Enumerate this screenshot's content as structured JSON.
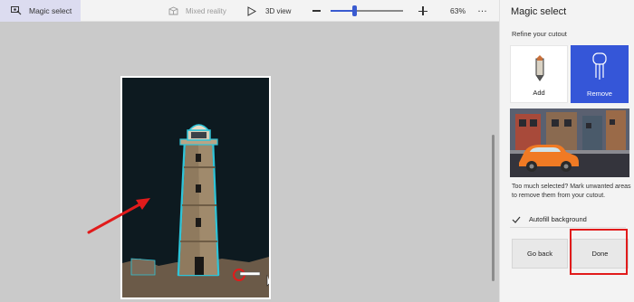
{
  "toolbar": {
    "active_tool": "Magic select",
    "active_tool_icon": "magic-select-icon",
    "mixed_reality": "Mixed reality",
    "view_3d": "3D view",
    "zoom_percent": "63%",
    "zoom_level": 0.33,
    "more": "…"
  },
  "panel": {
    "title": "Magic select",
    "refine_label": "Refine your cutout",
    "add_label": "Add",
    "remove_label": "Remove",
    "hint": "Too much selected? Mark unwanted areas to remove them from your cutout.",
    "autofill_label": "Autofill background",
    "autofill_checked": true,
    "back_label": "Go back",
    "done_label": "Done"
  },
  "colors": {
    "accent": "#3556d8",
    "annotation": "#e11b1b",
    "photo_bg": "#0d1a20",
    "selection_outline": "#2ec4d8"
  }
}
